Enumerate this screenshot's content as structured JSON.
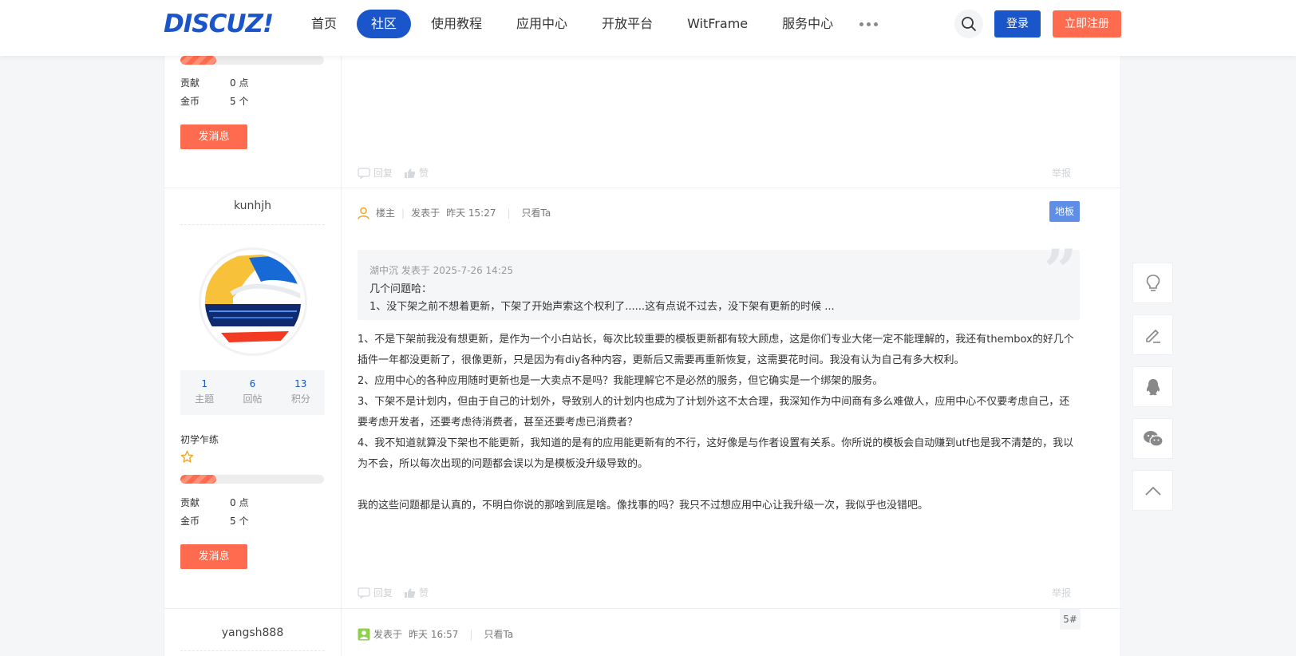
{
  "header": {
    "logo": "DISCUZ!",
    "nav": [
      "首页",
      "社区",
      "使用教程",
      "应用中心",
      "开放平台",
      "WitFrame",
      "服务中心"
    ],
    "active_nav": "社区",
    "login_label": "登录",
    "register_label": "立即注册"
  },
  "colors": {
    "brand_blue": "#1a56c9",
    "accent_orange": "#ff6b4e"
  },
  "prev_post": {
    "stats": [
      {
        "key": "贡献",
        "value": "0 点"
      },
      {
        "key": "金币",
        "value": "5 个"
      }
    ],
    "message_button": "发消息",
    "actions": {
      "reply": "回复",
      "like": "赞",
      "report": "举报"
    }
  },
  "post": {
    "author": "kunhjh",
    "counts": [
      {
        "num": "1",
        "label": "主题"
      },
      {
        "num": "6",
        "label": "回帖"
      },
      {
        "num": "13",
        "label": "积分"
      }
    ],
    "rank": "初学乍练",
    "stats": [
      {
        "key": "贡献",
        "value": "0 点"
      },
      {
        "key": "金币",
        "value": "5 个"
      }
    ],
    "message_button": "发消息",
    "meta": {
      "role": "楼主",
      "posted": "发表于",
      "time": "昨天 15:27",
      "only_ta": "只看Ta"
    },
    "floor": "地板",
    "quote": {
      "header": "湖中沉 发表于 2025-7-26 14:25",
      "lines": [
        "几个问题哈：",
        "1、没下架之前不想着更新，下架了开始声索这个权利了......这有点说不过去，没下架有更新的时候 ..."
      ]
    },
    "body": [
      "1、不是下架前我没有想更新，是作为一个小白站长，每次比较重要的模板更新都有较大顾虑，这是你们专业大佬一定不能理解的，我还有thembox的好几个插件一年都没更新了，很像更新，只是因为有diy各种内容，更新后又需要再重新恢复，这需要花时间。我没有认为自己有多大权利。",
      "2、应用中心的各种应用随时更新也是一大卖点不是吗？我能理解它不是必然的服务，但它确实是一个绑架的服务。",
      "3、下架不是计划内，但由于自己的计划外，导致别人的计划内也成为了计划外这不太合理，我深知作为中间商有多么难做人，应用中心不仅要考虑自己，还要考虑开发者，还要考虑待消费者，甚至还要考虑已消费者？",
      "4、我不知道就算没下架也不能更新，我知道的是有的应用能更新有的不行，这好像是与作者设置有关系。你所说的模板会自动赚到utf也是我不清楚的，我以为不会，所以每次出现的问题都会误以为是模板没升级导致的。",
      "我的这些问题都是认真的，不明白你说的那啥到底是啥。像找事的吗？我只不过想应用中心让我升级一次，我似乎也没错吧。"
    ],
    "actions": {
      "reply": "回复",
      "like": "赞",
      "report": "举报"
    }
  },
  "next_post": {
    "author": "yangsh888",
    "meta": {
      "posted": "发表于",
      "time": "昨天 16:57",
      "only_ta": "只看Ta"
    },
    "floor": "5#"
  }
}
